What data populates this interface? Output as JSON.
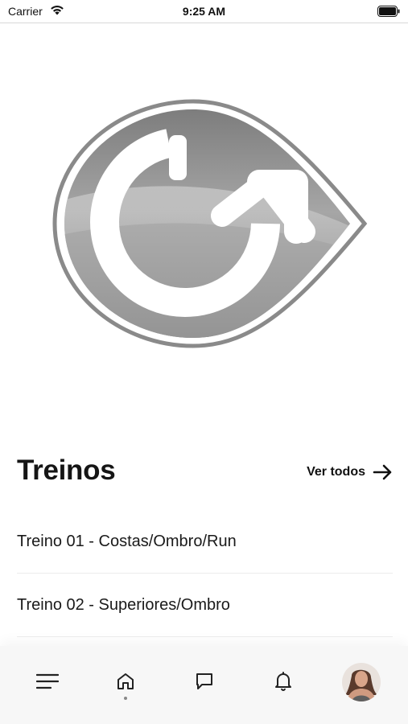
{
  "status_bar": {
    "carrier": "Carrier",
    "time": "9:25 AM"
  },
  "section": {
    "title": "Treinos",
    "see_all_label": "Ver todos"
  },
  "workouts": [
    {
      "label": "Treino 01 - Costas/Ombro/Run"
    },
    {
      "label": "Treino 02 - Superiores/Ombro"
    }
  ],
  "tabbar": {
    "items": [
      "menu-icon",
      "home-icon",
      "chat-icon",
      "bell-icon",
      "avatar"
    ],
    "active": "home-icon"
  }
}
